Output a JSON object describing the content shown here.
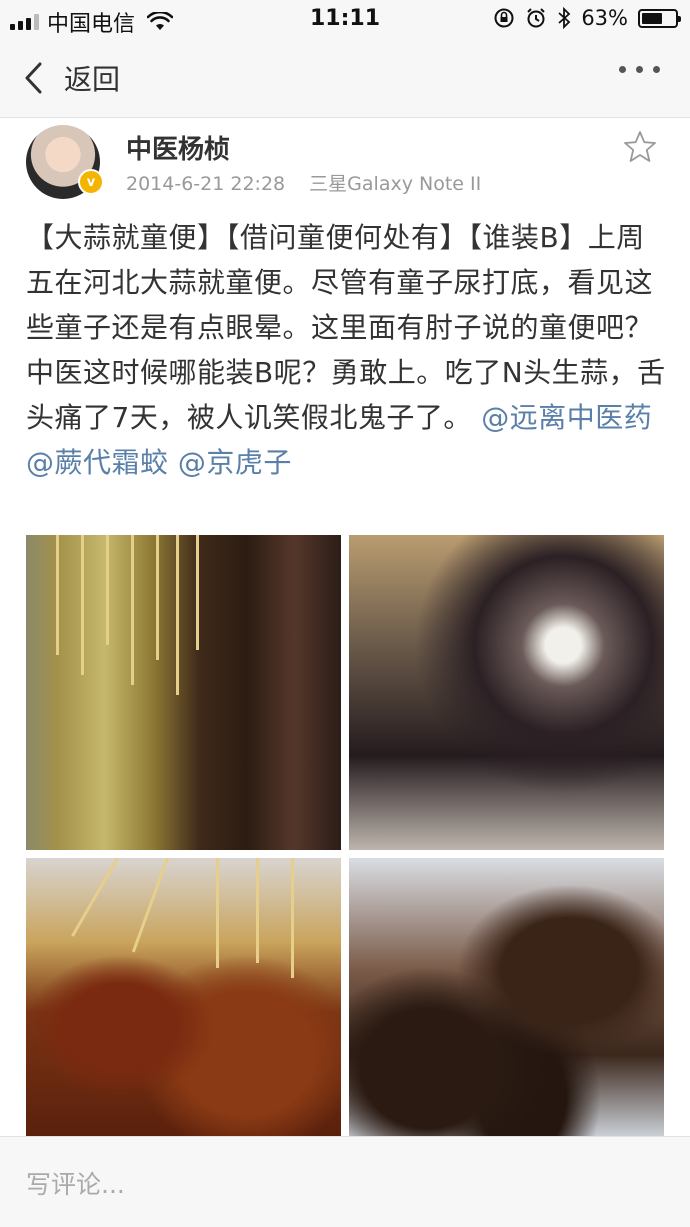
{
  "status_bar": {
    "carrier": "中国电信",
    "time": "11:11",
    "battery_percent": "63%",
    "battery_level": 0.63,
    "icons": [
      "signal-icon",
      "wifi-icon",
      "orientation-lock-icon",
      "alarm-icon",
      "bluetooth-icon",
      "battery-icon"
    ]
  },
  "nav": {
    "back_label": "返回",
    "more_icon": "more-icon"
  },
  "post": {
    "author": "中医杨桢",
    "verified_icon": "verified-badge-icon",
    "date": "2014-6-21 22:28",
    "device": "三星Galaxy Note II",
    "favorite_icon": "star-icon",
    "text": "【大蒜就童便】【借问童便何处有】【谁装B】上周五在河北大蒜就童便。尽管有童子尿打底，看见这些童子还是有点眼晕。这里面有肘子说的童便吧？中医这时候哪能装B呢？勇敢上。吃了N头生蒜，舌头痛了7天，被人讥笑假北鬼子了。",
    "mentions": [
      "@远离中医药",
      "@蕨代霜蛟",
      "@京虎子"
    ],
    "images": [
      "image-1",
      "image-2",
      "image-3",
      "image-4"
    ]
  },
  "comment": {
    "placeholder": "写评论..."
  },
  "colors": {
    "mention": "#5a7fa8",
    "meta": "#999999",
    "verified": "#f5b400",
    "bar_background": "#f7f7f7"
  }
}
